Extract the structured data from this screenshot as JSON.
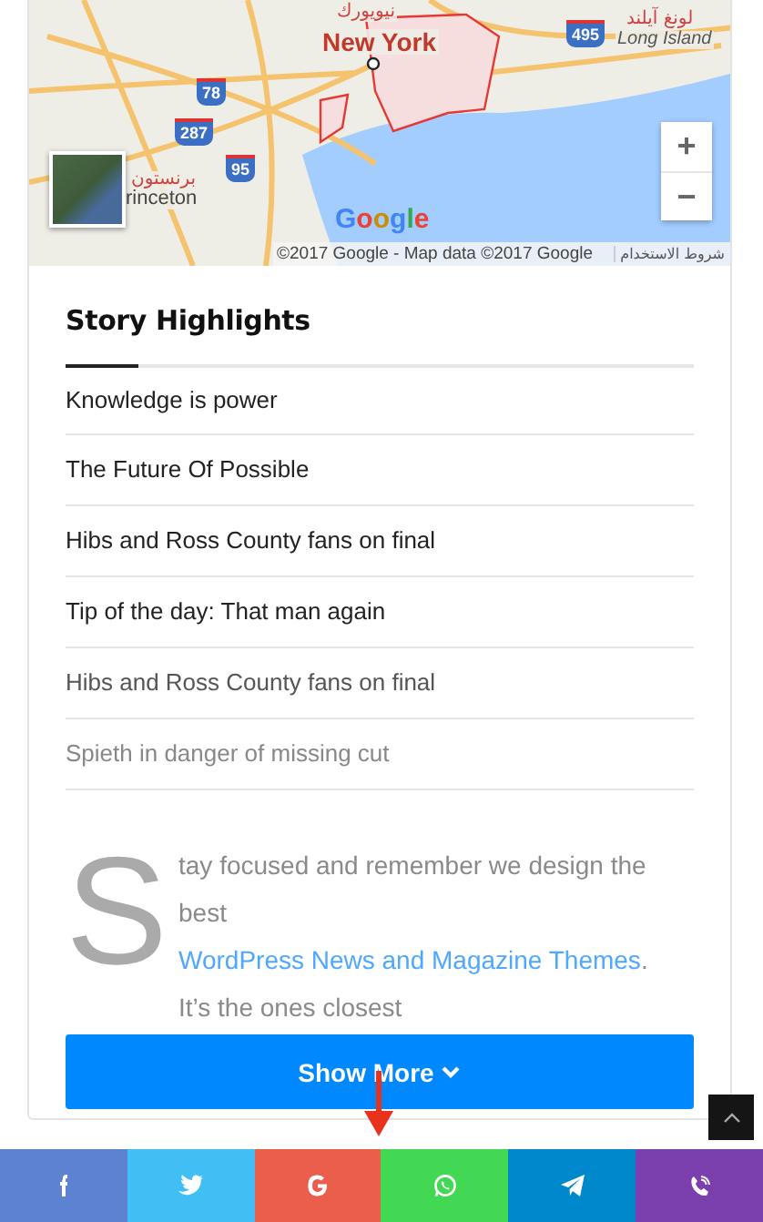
{
  "map": {
    "labels": [
      {
        "kind": "place-ar",
        "text": "نيويورك"
      },
      {
        "kind": "city",
        "text": "New York"
      },
      {
        "kind": "shield",
        "text": "495"
      },
      {
        "kind": "place-ar",
        "text": "لونغ آيلند"
      },
      {
        "kind": "region",
        "text": "Long Island"
      },
      {
        "kind": "shield",
        "text": "78"
      },
      {
        "kind": "shield",
        "text": "287"
      },
      {
        "kind": "shield",
        "text": "95"
      },
      {
        "kind": "place-ar",
        "text": "برنستون"
      },
      {
        "kind": "place",
        "text": "rinceton"
      }
    ],
    "logo": "Google",
    "attribution": "©2017 Google - Map data ©2017 Google",
    "terms": "شروط الاستخدام",
    "zoom_in": "+",
    "zoom_out": "−"
  },
  "highlights": {
    "title": "Story Highlights",
    "items": [
      "Knowledge is power",
      "The Future Of Possible",
      "Hibs and Ross County fans on final",
      "Tip of the day: That man again",
      "Hibs and Ross County fans on final",
      "Spieth in danger of missing cut"
    ]
  },
  "article": {
    "drop_cap": "S",
    "text": "tay focused and remember we design the best **WordPress News and Magazine Themes**. It’s the ones closest"
  },
  "show_more": {
    "label": "Show More"
  },
  "share_buttons": [
    {
      "kind": "facebook",
      "color": "#5d82d1"
    },
    {
      "kind": "twitter",
      "color": "#40bff5"
    },
    {
      "kind": "google",
      "color": "#eb5e4c"
    },
    {
      "kind": "whatsapp",
      "color": "#43d854"
    },
    {
      "kind": "telegram",
      "color": "#0088cc"
    },
    {
      "kind": "viber",
      "color": "#7b3fae"
    }
  ]
}
